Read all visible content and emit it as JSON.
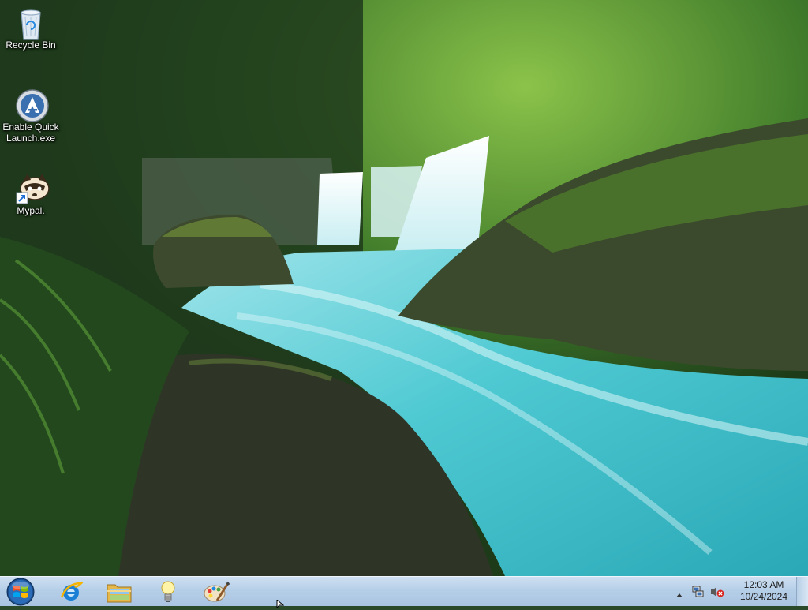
{
  "desktop": {
    "icons": [
      {
        "label": "Recycle Bin",
        "icon": "recycle-bin-icon"
      },
      {
        "label": "Enable Quick\nLaunch.exe",
        "icon": "quick-launch-icon"
      },
      {
        "label": "Mypal.",
        "icon": "mypal-icon"
      }
    ]
  },
  "taskbar": {
    "start": {
      "icon": "windows-orb-icon"
    },
    "pinned": [
      {
        "icon": "internet-explorer-icon"
      },
      {
        "icon": "folder-icon"
      },
      {
        "icon": "lightbulb-icon"
      },
      {
        "icon": "paint-icon"
      }
    ],
    "tray": {
      "time": "12:03 AM",
      "date": "10/24/2024",
      "icons": [
        "show-hidden-icons-icon",
        "network-icon",
        "volume-muted-icon"
      ]
    }
  },
  "colors": {
    "taskbar_top": "#cfe0f1",
    "taskbar_bottom": "#a9c4e2",
    "water": "#4ec9d2"
  }
}
